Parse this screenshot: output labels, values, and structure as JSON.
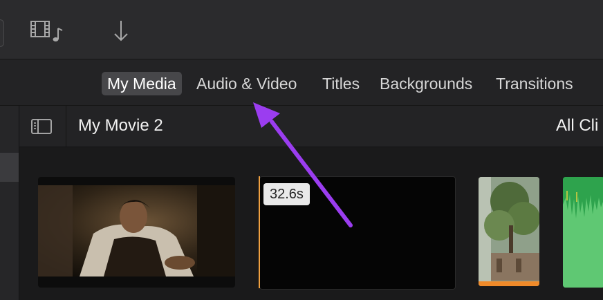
{
  "toolbar": {
    "media_icon": "film-music-icon",
    "import_icon": "down-arrow-icon"
  },
  "tabs": [
    {
      "label": "My Media",
      "selected": true
    },
    {
      "label": "Audio & Video",
      "selected": false
    },
    {
      "label": "Titles",
      "selected": false
    },
    {
      "label": "Backgrounds",
      "selected": false
    },
    {
      "label": "Transitions",
      "selected": false
    }
  ],
  "header": {
    "sidebar_toggle_icon": "sidebar-toggle-icon",
    "project_title": "My Movie 2",
    "filter_label": "All Cli"
  },
  "clips": [
    {
      "kind": "video",
      "thumbnail": "man-in-vest-scene"
    },
    {
      "kind": "video",
      "duration": "32.6s",
      "thumbnail": "black-frame"
    },
    {
      "kind": "video",
      "thumbnail": "tree-garden"
    },
    {
      "kind": "audio",
      "thumbnail": "green-waveform"
    }
  ],
  "colors": {
    "annotation_arrow": "#9b3df0",
    "playhead": "#f0a040",
    "selected_tab_bg": "#47474a",
    "audio_clip": "#2ea34d",
    "clip_range_bar": "#ef8a2a"
  }
}
